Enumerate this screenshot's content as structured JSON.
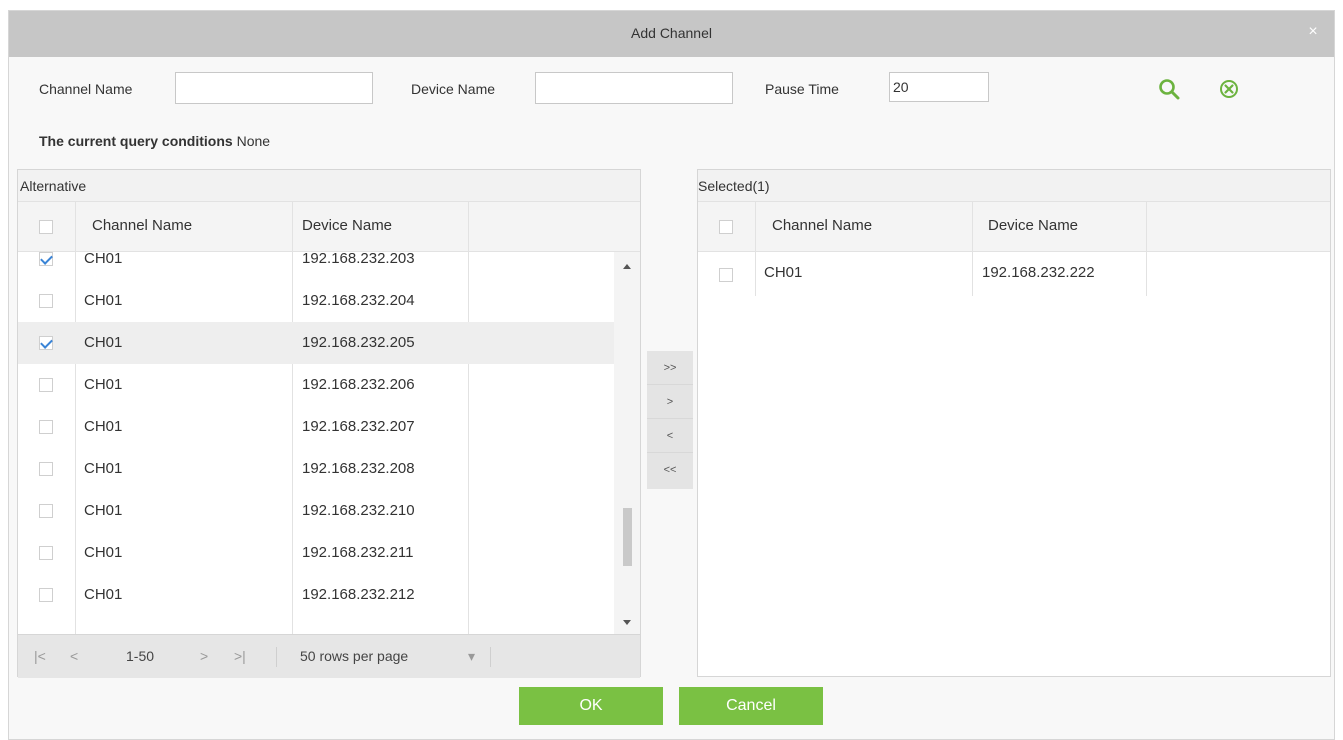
{
  "dialog": {
    "title": "Add Channel",
    "close_glyph": "×"
  },
  "query": {
    "channel_name_label": "Channel Name",
    "channel_name_value": "",
    "device_name_label": "Device Name",
    "device_name_value": "",
    "pause_time_label": "Pause Time",
    "pause_time_value": "20",
    "search_icon": "search-icon",
    "clear_icon": "clear-circle-icon"
  },
  "conditions": {
    "label": "The current query conditions",
    "value": "None"
  },
  "alternative": {
    "title": "Alternative",
    "columns": [
      "Channel Name",
      "Device Name"
    ],
    "rows": [
      {
        "checked": true,
        "channel": "CH01",
        "device": "192.168.232.203"
      },
      {
        "checked": false,
        "channel": "CH01",
        "device": "192.168.232.204"
      },
      {
        "checked": true,
        "channel": "CH01",
        "device": "192.168.232.205"
      },
      {
        "checked": false,
        "channel": "CH01",
        "device": "192.168.232.206"
      },
      {
        "checked": false,
        "channel": "CH01",
        "device": "192.168.232.207"
      },
      {
        "checked": false,
        "channel": "CH01",
        "device": "192.168.232.208"
      },
      {
        "checked": false,
        "channel": "CH01",
        "device": "192.168.232.210"
      },
      {
        "checked": false,
        "channel": "CH01",
        "device": "192.168.232.211"
      },
      {
        "checked": false,
        "channel": "CH01",
        "device": "192.168.232.212"
      }
    ],
    "pager": {
      "first": "|<",
      "prev": "<",
      "range": "1-50",
      "next": ">",
      "last": ">|",
      "rows_per_page": "50 rows per page",
      "dropdown_glyph": "▾"
    }
  },
  "transfer": {
    "all_right": ">>",
    "right": ">",
    "left": "<",
    "all_left": "<<"
  },
  "selected": {
    "title": "Selected(1)",
    "columns": [
      "Channel Name",
      "Device Name"
    ],
    "rows": [
      {
        "checked": false,
        "channel": "CH01",
        "device": "192.168.232.222"
      }
    ]
  },
  "footer": {
    "ok_label": "OK",
    "cancel_label": "Cancel"
  },
  "colors": {
    "accent_green": "#7ac143",
    "check_blue": "#3a84d6",
    "title_bar": "#c6c6c6"
  }
}
